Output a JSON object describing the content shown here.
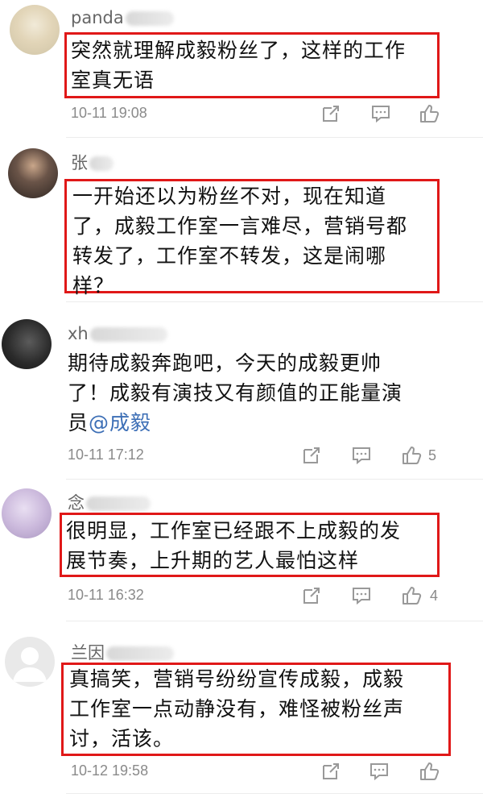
{
  "comments": [
    {
      "username": "panda",
      "text": "突然就理解成毅粉丝了，这样的工作室真无语",
      "lines": [
        "突然就理解成毅粉丝了，这样的工作",
        "室真无语"
      ],
      "time": "10-11 19:08",
      "likes": "",
      "highlighted": true
    },
    {
      "username": "张",
      "lines": [
        "一开始还以为粉丝不对，现在知道",
        "了，成毅工作室一言难尽，营销号都",
        "转发了，工作室不转发，这是闹哪",
        "样？"
      ],
      "time": "",
      "likes": "",
      "highlighted": true
    },
    {
      "username": "xh",
      "lines": [
        "期待成毅奔跑吧，今天的成毅更帅",
        "了！成毅有演技又有颜值的正能量演",
        "员"
      ],
      "mention": "@成毅",
      "time": "10-11 17:12",
      "likes": "5",
      "highlighted": false
    },
    {
      "username": "念",
      "lines": [
        "很明显，工作室已经跟不上成毅的发",
        "展节奏，上升期的艺人最怕这样"
      ],
      "time": "10-11 16:32",
      "likes": "4",
      "highlighted": true
    },
    {
      "username": "兰因",
      "lines": [
        "真搞笑，营销号纷纷宣传成毅，成毅",
        "工作室一点动静没有，难怪被粉丝声",
        "讨，活该。"
      ],
      "time": "10-12 19:58",
      "likes": "",
      "highlighted": true
    }
  ],
  "icons": {
    "share": "share-icon",
    "reply": "reply-icon",
    "like": "like-icon"
  },
  "colors": {
    "highlight": "#e01818",
    "mention": "#3d6fb6",
    "meta": "#8a8a8a"
  }
}
